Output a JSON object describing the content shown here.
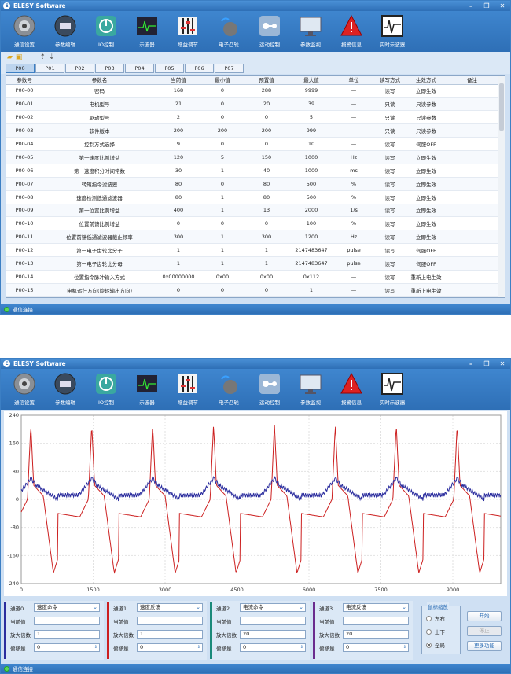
{
  "app_title": "ELESY Software",
  "toolbar": [
    "通信设置",
    "参数编辑",
    "IO控制",
    "示波器",
    "增益调节",
    "电子凸轮",
    "运动控制",
    "参数监视",
    "报警信息",
    "实时示波器"
  ],
  "status": "通信连接",
  "param_tabs": [
    "P00",
    "P01",
    "P02",
    "P03",
    "P04",
    "P05",
    "P06",
    "P07"
  ],
  "table": {
    "headers": [
      "参数号",
      "参数名",
      "当前值",
      "最小值",
      "预置值",
      "最大值",
      "单位",
      "读写方式",
      "生效方式",
      "备注"
    ],
    "rows": [
      [
        "P00-00",
        "密码",
        "168",
        "0",
        "288",
        "9999",
        "—",
        "读写",
        "立即生效",
        ""
      ],
      [
        "P00-01",
        "电机型号",
        "21",
        "0",
        "20",
        "39",
        "—",
        "只读",
        "只读参数",
        ""
      ],
      [
        "P00-02",
        "驱动型号",
        "2",
        "0",
        "0",
        "5",
        "—",
        "只读",
        "只读参数",
        ""
      ],
      [
        "P00-03",
        "软件版本",
        "200",
        "200",
        "200",
        "999",
        "—",
        "只读",
        "只读参数",
        ""
      ],
      [
        "P00-04",
        "控制方式选择",
        "9",
        "0",
        "0",
        "10",
        "—",
        "读写",
        "伺服OFF",
        ""
      ],
      [
        "P00-05",
        "第一速度比例增益",
        "120",
        "5",
        "150",
        "1000",
        "Hz",
        "读写",
        "立即生效",
        ""
      ],
      [
        "P00-06",
        "第一速度积分时间常数",
        "30",
        "1",
        "40",
        "1000",
        "ms",
        "读写",
        "立即生效",
        ""
      ],
      [
        "P00-07",
        "转矩指令滤波器",
        "80",
        "0",
        "80",
        "500",
        "%",
        "读写",
        "立即生效",
        ""
      ],
      [
        "P00-08",
        "速度检测低通滤波器",
        "80",
        "1",
        "80",
        "500",
        "%",
        "读写",
        "立即生效",
        ""
      ],
      [
        "P00-09",
        "第一位置比例增益",
        "400",
        "1",
        "13",
        "2000",
        "1/s",
        "读写",
        "立即生效",
        ""
      ],
      [
        "P00-10",
        "位置前馈比例增益",
        "0",
        "0",
        "0",
        "100",
        "%",
        "读写",
        "立即生效",
        ""
      ],
      [
        "P00-11",
        "位置前馈低通滤波器截止频率",
        "300",
        "1",
        "300",
        "1200",
        "Hz",
        "读写",
        "立即生效",
        ""
      ],
      [
        "P00-12",
        "第一电子齿轮比分子",
        "1",
        "1",
        "1",
        "2147483647",
        "pulse",
        "读写",
        "伺服OFF",
        ""
      ],
      [
        "P00-13",
        "第一电子齿轮比分母",
        "1",
        "1",
        "1",
        "2147483647",
        "pulse",
        "读写",
        "伺服OFF",
        ""
      ],
      [
        "P00-14",
        "位置指令脉冲输入方式",
        "0x00000000",
        "0x00",
        "0x00",
        "0x112",
        "—",
        "读写",
        "重新上电生效",
        ""
      ],
      [
        "P00-15",
        "电机运行方向(旋转输出方向)",
        "0",
        "0",
        "0",
        "1",
        "—",
        "读写",
        "重新上电生效",
        ""
      ]
    ]
  },
  "chart_data": {
    "type": "line",
    "xlim": [
      0,
      10000
    ],
    "ylim": [
      -240,
      240
    ],
    "x_ticks": [
      "0",
      "1500",
      "3000",
      "4500",
      "6000",
      "7500",
      "9000"
    ],
    "y_ticks": [
      "240",
      "160",
      "80",
      "0",
      "-80",
      "-160",
      "-240"
    ],
    "period": 1270,
    "first_peak_x": 200,
    "series": [
      {
        "color": "#cc1f1f",
        "peak": 213,
        "trough": -210
      },
      {
        "color": "#2b2d9e",
        "peak": 65,
        "trough": 10
      }
    ]
  },
  "channels": [
    {
      "label": "通道0",
      "signal": "速度命令",
      "color": "#2b2d9e",
      "current_label": "当前值",
      "current": "",
      "gain_label": "放大倍数",
      "gain": "1",
      "offset_label": "偏移量",
      "offset": "0"
    },
    {
      "label": "通道1",
      "signal": "速度反馈",
      "color": "#cc1f1f",
      "current_label": "当前值",
      "current": "",
      "gain_label": "放大倍数",
      "gain": "1",
      "offset_label": "偏移量",
      "offset": "0"
    },
    {
      "label": "通道2",
      "signal": "电流命令",
      "color": "#1a8a7a",
      "current_label": "当前值",
      "current": "",
      "gain_label": "放大倍数",
      "gain": "20",
      "offset_label": "偏移量",
      "offset": "0"
    },
    {
      "label": "通道3",
      "signal": "电流反馈",
      "color": "#6a2b8e",
      "current_label": "当前值",
      "current": "",
      "gain_label": "放大倍数",
      "gain": "20",
      "offset_label": "偏移量",
      "offset": "0"
    }
  ],
  "zoom": {
    "legend": "鼠标缩放",
    "options": [
      "左右",
      "上下",
      "全局"
    ],
    "selected": 2
  },
  "buttons": {
    "start": "开始",
    "stop": "停止",
    "more": "更多功能"
  }
}
